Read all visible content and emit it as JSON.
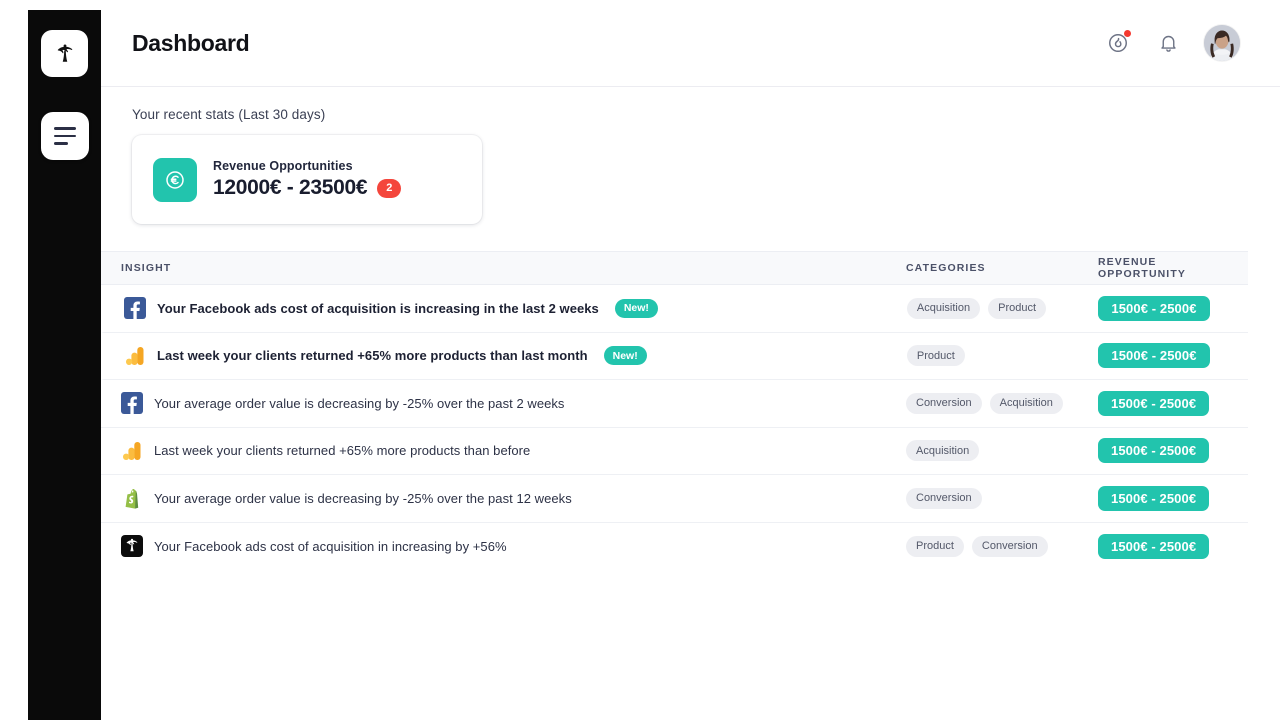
{
  "sidebar": {
    "logo_icon": "palm-tree-logo-icon",
    "menu_icon": "menu-lines-icon"
  },
  "header": {
    "title": "Dashboard",
    "activity_icon": "flame-circle-icon",
    "notifications_icon": "bell-icon",
    "avatar_alt": "user-avatar",
    "has_activity_badge": true
  },
  "stats": {
    "label": "Your recent stats (Last 30 days)",
    "card": {
      "icon": "euro-circle-icon",
      "title": "Revenue Opportunities",
      "value": "12000€ - 23500€",
      "badge_count": "2",
      "accent_color": "#14c2ac",
      "badge_color": "#f4463c"
    }
  },
  "table": {
    "columns": {
      "insight": "INSIGHT",
      "categories": "CATEGORIES",
      "revenue": "REVENUE OPPORTUNITY"
    },
    "rows": [
      {
        "source_icon": "facebook-icon",
        "text": "Your Facebook ads cost of acquisition is increasing in the last 2 weeks",
        "unread": true,
        "new_label": "New!",
        "categories": [
          "Acquisition",
          "Product"
        ],
        "revenue": "1500€ - 2500€"
      },
      {
        "source_icon": "google-analytics-icon",
        "text": "Last week your clients returned +65% more products than last month",
        "unread": true,
        "new_label": "New!",
        "categories": [
          "Product"
        ],
        "revenue": "1500€ - 2500€"
      },
      {
        "source_icon": "facebook-icon",
        "text": "Your average order value is decreasing by -25% over the past 2 weeks",
        "unread": false,
        "new_label": "",
        "categories": [
          "Conversion",
          "Acquisition"
        ],
        "revenue": "1500€ - 2500€"
      },
      {
        "source_icon": "google-analytics-icon",
        "text": "Last week your clients returned +65% more products than before",
        "unread": false,
        "new_label": "",
        "categories": [
          "Acquisition"
        ],
        "revenue": "1500€ - 2500€"
      },
      {
        "source_icon": "shopify-icon",
        "text": "Your average order value is decreasing by -25% over the past 12 weeks",
        "unread": false,
        "new_label": "",
        "categories": [
          "Conversion"
        ],
        "revenue": "1500€ - 2500€"
      },
      {
        "source_icon": "palm-tree-logo-icon",
        "text": "Your Facebook ads cost of acquisition in increasing by +56%",
        "unread": false,
        "new_label": "",
        "categories": [
          "Product",
          "Conversion"
        ],
        "revenue": "1500€ - 2500€"
      }
    ]
  },
  "colors": {
    "accent_teal": "#22c4ad",
    "danger_red": "#f4463c",
    "sidebar_black": "#0a0a0a"
  }
}
